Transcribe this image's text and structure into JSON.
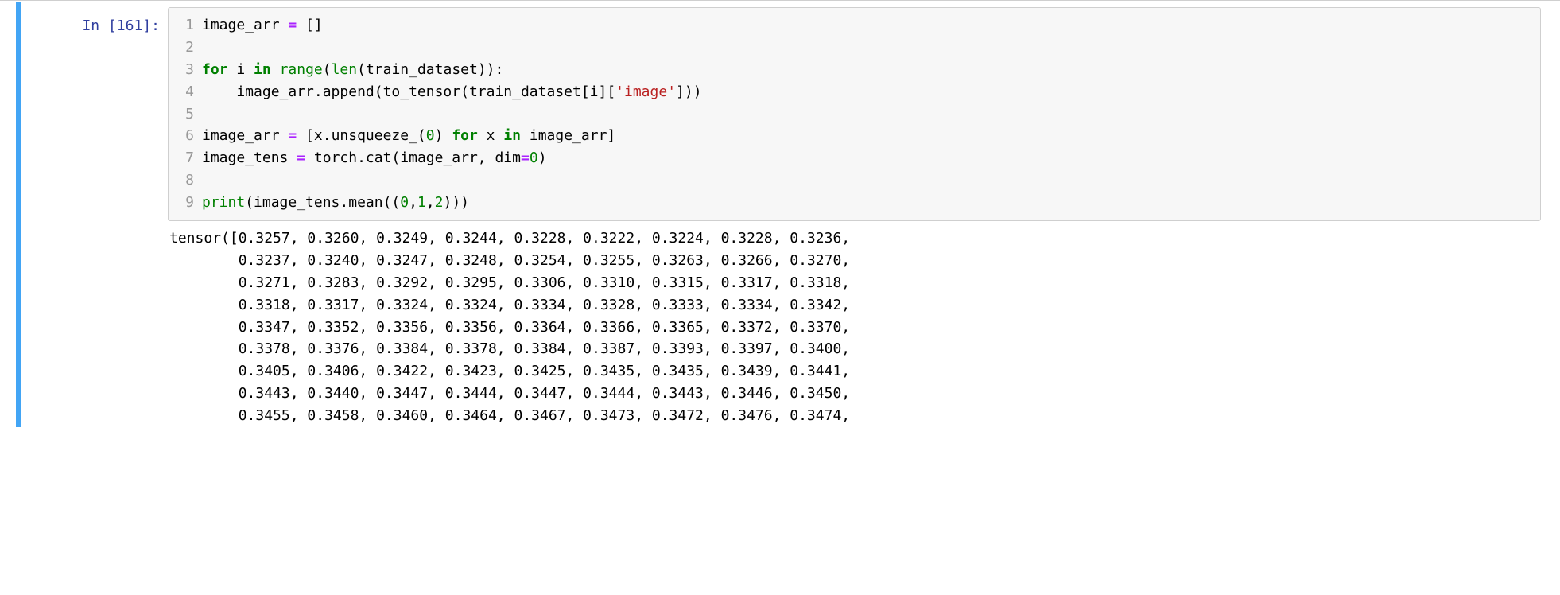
{
  "prompt": "In [161]:",
  "gutter": [
    "1",
    "2",
    "3",
    "4",
    "5",
    "6",
    "7",
    "8",
    "9"
  ],
  "code": {
    "l1_a": "image_arr ",
    "l1_eq": "=",
    "l1_b": " []",
    "l3_for": "for",
    "l3_a": " i ",
    "l3_in": "in",
    "l3_sp": " ",
    "l3_range": "range",
    "l3_p1": "(",
    "l3_len": "len",
    "l3_p2": "(train_dataset)):",
    "l4_a": "    image_arr.append(to_tensor(train_dataset[i][",
    "l4_str": "'image'",
    "l4_b": "]))",
    "l6_a": "image_arr ",
    "l6_eq": "=",
    "l6_b": " [x.unsqueeze_(",
    "l6_zero": "0",
    "l6_c": ") ",
    "l6_for": "for",
    "l6_d": " x ",
    "l6_in": "in",
    "l6_e": " image_arr]",
    "l7_a": "image_tens ",
    "l7_eq": "=",
    "l7_b": " torch.cat(image_arr, dim",
    "l7_eq2": "=",
    "l7_zero": "0",
    "l7_c": ")",
    "l9_print": "print",
    "l9_a": "(image_tens.mean((",
    "l9_n0": "0",
    "l9_c1": ",",
    "l9_n1": "1",
    "l9_c2": ",",
    "l9_n2": "2",
    "l9_b": ")))"
  },
  "output": "tensor([0.3257, 0.3260, 0.3249, 0.3244, 0.3228, 0.3222, 0.3224, 0.3228, 0.3236,\n        0.3237, 0.3240, 0.3247, 0.3248, 0.3254, 0.3255, 0.3263, 0.3266, 0.3270,\n        0.3271, 0.3283, 0.3292, 0.3295, 0.3306, 0.3310, 0.3315, 0.3317, 0.3318,\n        0.3318, 0.3317, 0.3324, 0.3324, 0.3334, 0.3328, 0.3333, 0.3334, 0.3342,\n        0.3347, 0.3352, 0.3356, 0.3356, 0.3364, 0.3366, 0.3365, 0.3372, 0.3370,\n        0.3378, 0.3376, 0.3384, 0.3378, 0.3384, 0.3387, 0.3393, 0.3397, 0.3400,\n        0.3405, 0.3406, 0.3422, 0.3423, 0.3425, 0.3435, 0.3435, 0.3439, 0.3441,\n        0.3443, 0.3440, 0.3447, 0.3444, 0.3447, 0.3444, 0.3443, 0.3446, 0.3450,\n        0.3455, 0.3458, 0.3460, 0.3464, 0.3467, 0.3473, 0.3472, 0.3476, 0.3474,"
}
